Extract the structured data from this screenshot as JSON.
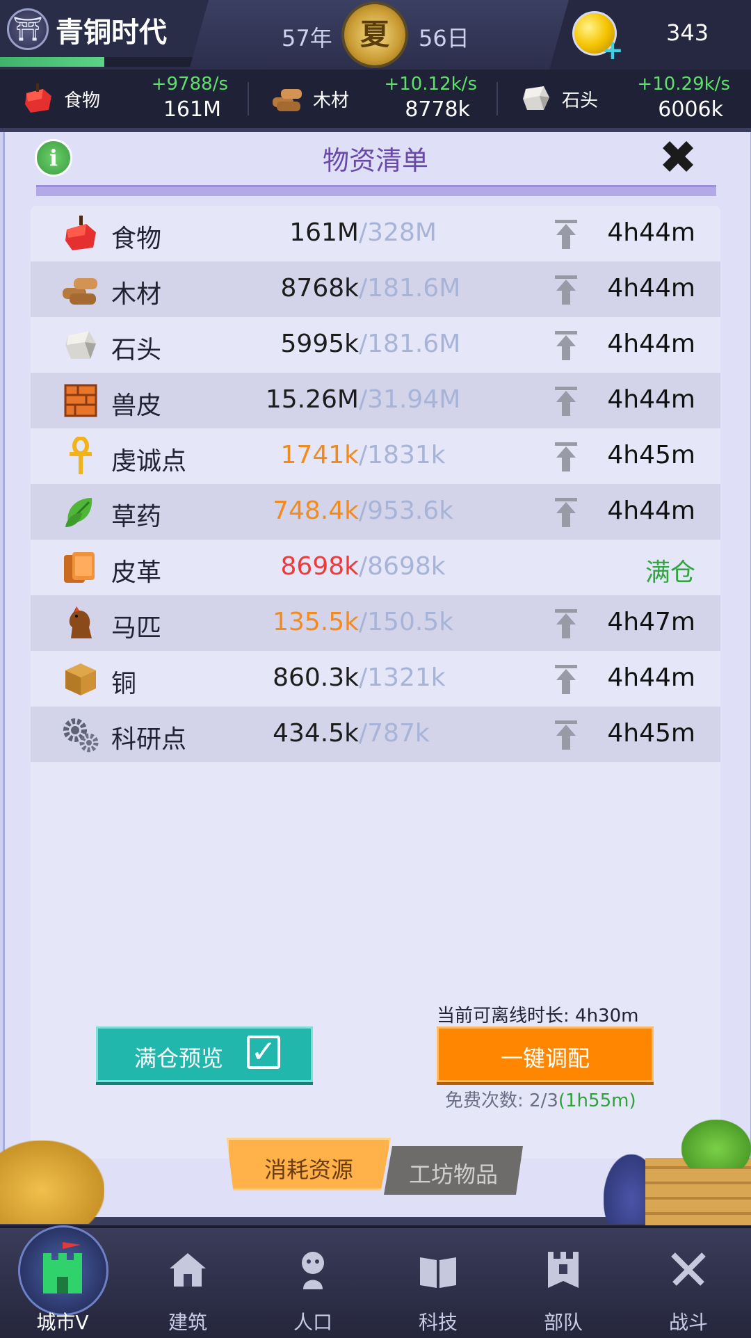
{
  "header": {
    "era_name": "青铜时代",
    "era_icon": "gate-icon",
    "era_progress": 0.5,
    "year": "57年",
    "season": "夏",
    "day": "56日",
    "coin_icon": "gold-coin-icon",
    "coin_count": "343"
  },
  "resource_bar": [
    {
      "name": "食物",
      "icon": "apple-icon",
      "rate": "+9788/s",
      "amount": "161M"
    },
    {
      "name": "木材",
      "icon": "wood-icon",
      "rate": "+10.12k/s",
      "amount": "8778k"
    },
    {
      "name": "石头",
      "icon": "stone-icon",
      "rate": "+10.29k/s",
      "amount": "6006k"
    }
  ],
  "panel": {
    "title": "物资清单",
    "info_label": "i",
    "close_label": "✖"
  },
  "rows": [
    {
      "name": "食物",
      "current": "161M",
      "max": "/328M",
      "time": "4h44m",
      "status": "normal"
    },
    {
      "name": "木材",
      "current": "8768k",
      "max": "/181.6M",
      "time": "4h44m",
      "status": "normal"
    },
    {
      "name": "石头",
      "current": "5995k",
      "max": "/181.6M",
      "time": "4h44m",
      "status": "normal"
    },
    {
      "name": "兽皮",
      "current": "15.26M",
      "max": "/31.94M",
      "time": "4h44m",
      "status": "normal"
    },
    {
      "name": "虔诚点",
      "current": "1741k",
      "max": "/1831k",
      "time": "4h45m",
      "status": "warning"
    },
    {
      "name": "草药",
      "current": "748.4k",
      "max": "/953.6k",
      "time": "4h44m",
      "status": "warning"
    },
    {
      "name": "皮革",
      "current": "8698k",
      "max": "/8698k",
      "time": "满仓",
      "status": "full"
    },
    {
      "name": "马匹",
      "current": "135.5k",
      "max": "/150.5k",
      "time": "4h47m",
      "status": "warning"
    },
    {
      "name": "铜",
      "current": "860.3k",
      "max": "/1321k",
      "time": "4h44m",
      "status": "normal"
    },
    {
      "name": "科研点",
      "current": "434.5k",
      "max": "/787k",
      "time": "4h45m",
      "status": "normal"
    }
  ],
  "actions": {
    "offline_label": "当前可离线时长: 4h30m",
    "preview_label": "满仓预览",
    "allocate_label": "一键调配",
    "free_prefix": "免费次数: 2/3",
    "free_time": "(1h55m)"
  },
  "sub_tabs": {
    "consume": "消耗资源",
    "workshop": "工坊物品"
  },
  "nav": [
    {
      "label": "城市V",
      "icon": "castle-icon",
      "active": true
    },
    {
      "label": "建筑",
      "icon": "house-icon"
    },
    {
      "label": "人口",
      "icon": "person-icon"
    },
    {
      "label": "科技",
      "icon": "book-icon"
    },
    {
      "label": "部队",
      "icon": "banner-icon"
    },
    {
      "label": "战斗",
      "icon": "crossed-swords-icon"
    }
  ],
  "colors": {
    "accent_green": "#5ee06a",
    "warning_orange": "#f28a1c",
    "full_red": "#ee3a3a",
    "full_text_green": "#2fa63e",
    "teal_button": "#21b7ad",
    "orange_button": "#ff8600"
  }
}
